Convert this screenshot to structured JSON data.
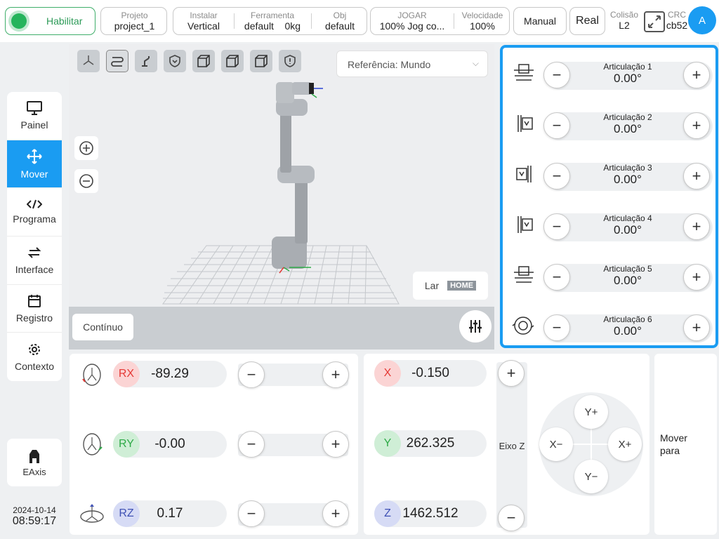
{
  "top": {
    "enable_label": "Habilitar",
    "project": {
      "label": "Projeto",
      "value": "project_1"
    },
    "install": {
      "label": "Instalar",
      "value": "Vertical"
    },
    "tool": {
      "label": "Ferramenta",
      "value": "default",
      "weight": "0kg"
    },
    "obj": {
      "label": "Obj",
      "value": "default"
    },
    "jog": {
      "label": "JOGAR",
      "value": "100%  Jog co..."
    },
    "speed": {
      "label": "Velocidade",
      "value": "100%"
    },
    "manual_label": "Manual",
    "real_label": "Real",
    "collision": {
      "label": "Colisão",
      "value": "L2"
    },
    "crc": {
      "label": "CRC",
      "value": "cb52"
    },
    "avatar": "A"
  },
  "sidebar": {
    "items": [
      {
        "label": "Painel",
        "icon": "monitor-icon"
      },
      {
        "label": "Mover",
        "icon": "move-icon"
      },
      {
        "label": "Programa",
        "icon": "code-icon"
      },
      {
        "label": "Interface",
        "icon": "swap-icon"
      },
      {
        "label": "Registro",
        "icon": "calendar-icon"
      },
      {
        "label": "Contexto",
        "icon": "gear-icon"
      }
    ],
    "eaxis_label": "EAxis",
    "date": "2024-10-14",
    "time": "08:59:17"
  },
  "viewer": {
    "reference": "Referência: Mundo",
    "home_label": "Lar",
    "home_badge": "HOME",
    "continuous_label": "Contínuo"
  },
  "joints": [
    {
      "name": "Articulação 1",
      "value": "0.00°"
    },
    {
      "name": "Articulação 2",
      "value": "0.00°"
    },
    {
      "name": "Articulação 3",
      "value": "0.00°"
    },
    {
      "name": "Articulação 4",
      "value": "0.00°"
    },
    {
      "name": "Articulação 5",
      "value": "0.00°"
    },
    {
      "name": "Articulação 6",
      "value": "0.00°"
    }
  ],
  "rotation": [
    {
      "axis": "RX",
      "value": "-89.29",
      "color": "#e53935"
    },
    {
      "axis": "RY",
      "value": "-0.00",
      "color": "#2eaa47"
    },
    {
      "axis": "RZ",
      "value": "0.17",
      "color": "#3f51b5"
    }
  ],
  "position": [
    {
      "axis": "X",
      "value": "-0.150",
      "color": "#e53935"
    },
    {
      "axis": "Y",
      "value": "262.325",
      "color": "#2eaa47"
    },
    {
      "axis": "Z",
      "value": "1462.512",
      "color": "#3f51b5"
    }
  ],
  "z_axis_label": "Eixo Z",
  "dpad": {
    "up": "Y+",
    "down": "Y−",
    "left": "X−",
    "right": "X+"
  },
  "move_to_label": "Mover para"
}
